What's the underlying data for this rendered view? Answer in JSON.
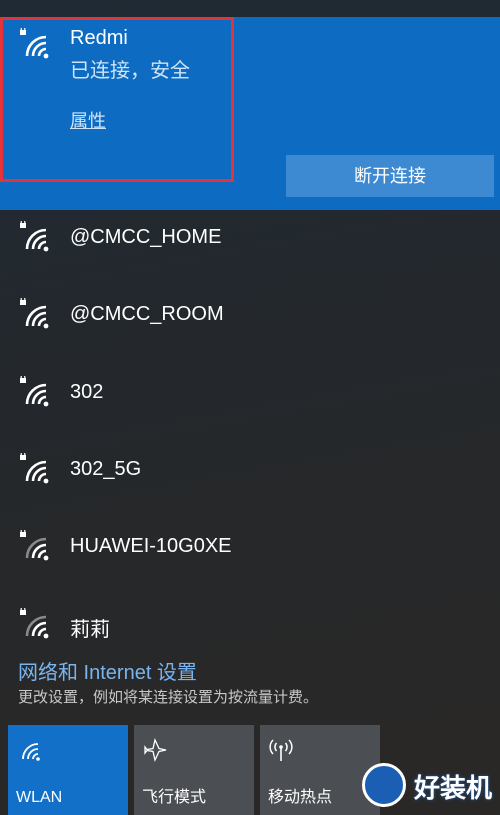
{
  "connected_network": {
    "name": "Redmi",
    "status": "已连接，安全",
    "properties_link": "属性",
    "disconnect_label": "断开连接",
    "icon": "wifi-secured-icon"
  },
  "networks": [
    {
      "name": "@CMCC_HOME",
      "icon": "wifi-secured-icon"
    },
    {
      "name": "@CMCC_ROOM",
      "icon": "wifi-secured-icon"
    },
    {
      "name": "302",
      "icon": "wifi-secured-icon"
    },
    {
      "name": "302_5G",
      "icon": "wifi-secured-icon"
    },
    {
      "name": "HUAWEI-10G0XE",
      "icon": "wifi-secured-weak-icon"
    },
    {
      "name": "莉莉",
      "icon": "wifi-secured-weak-icon"
    }
  ],
  "settings": {
    "link": "网络和 Internet 设置",
    "description": "更改设置，例如将某连接设置为按流量计费。"
  },
  "quick_actions": [
    {
      "label": "WLAN",
      "icon": "wifi-icon",
      "active": true
    },
    {
      "label": "飞行模式",
      "icon": "airplane-icon",
      "active": false
    },
    {
      "label": "移动热点",
      "icon": "hotspot-icon",
      "active": false
    }
  ],
  "watermark": {
    "text": "好装机"
  },
  "colors": {
    "accent": "#0d6cc2",
    "button": "#3d8ad2",
    "highlight": "#e5333a",
    "link": "#79b4ee",
    "tile_inactive": "#4b4e52"
  }
}
